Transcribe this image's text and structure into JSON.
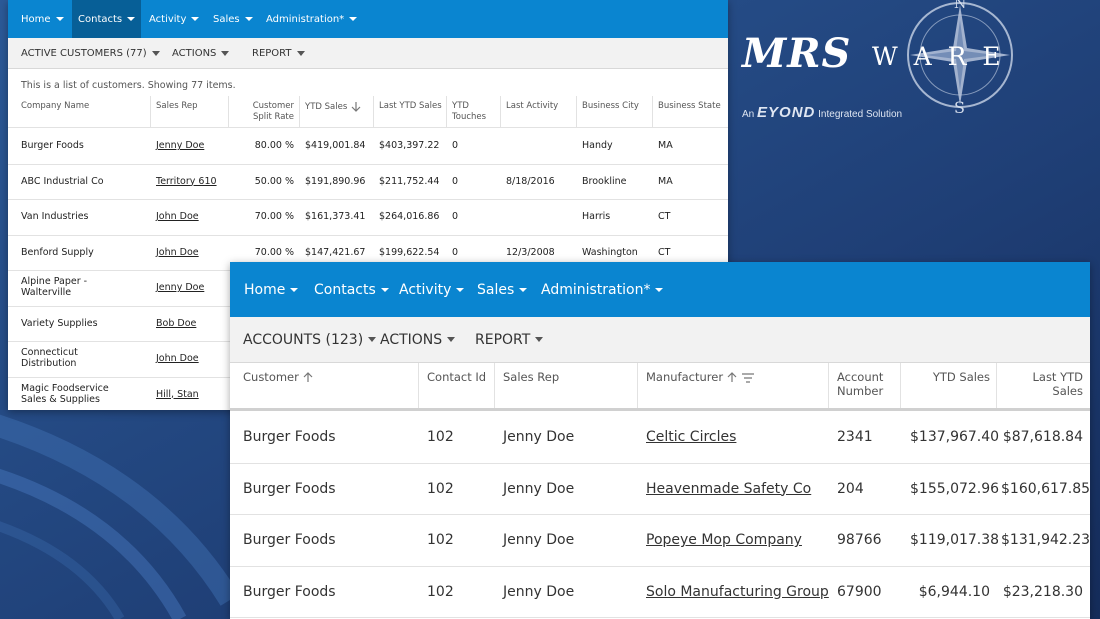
{
  "brand": {
    "name": "MRS",
    "name2": "W A R E",
    "tagline_pre": "An",
    "tagline_brand": "EYOND",
    "tagline_post": "Integrated Solution",
    "compass_n": "N",
    "compass_s": "S"
  },
  "win1": {
    "nav": [
      "Home",
      "Contacts",
      "Activity",
      "Sales",
      "Administration*"
    ],
    "toolbar": [
      "ACTIVE CUSTOMERS (77)",
      "ACTIONS",
      "REPORT"
    ],
    "note": "This is a list of customers. Showing 77 items.",
    "headers": [
      "Company Name",
      "Sales Rep",
      "Customer Split Rate",
      "YTD Sales",
      "Last YTD Sales",
      "YTD Touches",
      "Last Activity",
      "Business City",
      "Business State"
    ],
    "rows": [
      [
        "Burger Foods",
        "Jenny Doe",
        "80.00 %",
        "$419,001.84",
        "$403,397.22",
        "0",
        "",
        "Handy",
        "MA"
      ],
      [
        "ABC Industrial Co",
        "Territory 610",
        "50.00 %",
        "$191,890.96",
        "$211,752.44",
        "0",
        "8/18/2016",
        "Brookline",
        "MA"
      ],
      [
        "Van Industries",
        "John Doe",
        "70.00 %",
        "$161,373.41",
        "$264,016.86",
        "0",
        "",
        "Harris",
        "CT"
      ],
      [
        "Benford Supply",
        "John Doe",
        "70.00 %",
        "$147,421.67",
        "$199,622.54",
        "0",
        "12/3/2008",
        "Washington",
        "CT"
      ],
      [
        "Alpine Paper - Walterville",
        "Jenny Doe"
      ],
      [
        "Variety Supplies",
        "Bob Doe"
      ],
      [
        "Connecticut Distribution",
        "John Doe"
      ],
      [
        "Magic Foodservice Sales & Supplies",
        "Hill, Stan"
      ]
    ]
  },
  "win2": {
    "nav": [
      "Home",
      "Contacts",
      "Activity",
      "Sales",
      "Administration*"
    ],
    "toolbar": [
      "ACCOUNTS (123)",
      "ACTIONS",
      "REPORT"
    ],
    "headers": [
      "Customer",
      "Contact Id",
      "Sales Rep",
      "Manufacturer",
      "Account Number",
      "YTD Sales",
      "Last YTD Sales"
    ],
    "rows": [
      [
        "Burger Foods",
        "102",
        "Jenny Doe",
        "Celtic Circles",
        "2341",
        "$137,967.40",
        "$87,618.84"
      ],
      [
        "Burger Foods",
        "102",
        "Jenny Doe",
        "Heavenmade Safety Co",
        "204",
        "$155,072.96",
        "$160,617.85"
      ],
      [
        "Burger Foods",
        "102",
        "Jenny Doe",
        "Popeye Mop Company",
        "98766",
        "$119,017.38",
        "$131,942.23"
      ],
      [
        "Burger Foods",
        "102",
        "Jenny Doe",
        "Solo Manufacturing Group",
        "67900",
        "$6,944.10",
        "$23,218.30"
      ]
    ]
  },
  "colors": {
    "nav": "#0a85d0",
    "nav_active": "#075f97",
    "bg": "#24467f",
    "link": "#222222"
  }
}
